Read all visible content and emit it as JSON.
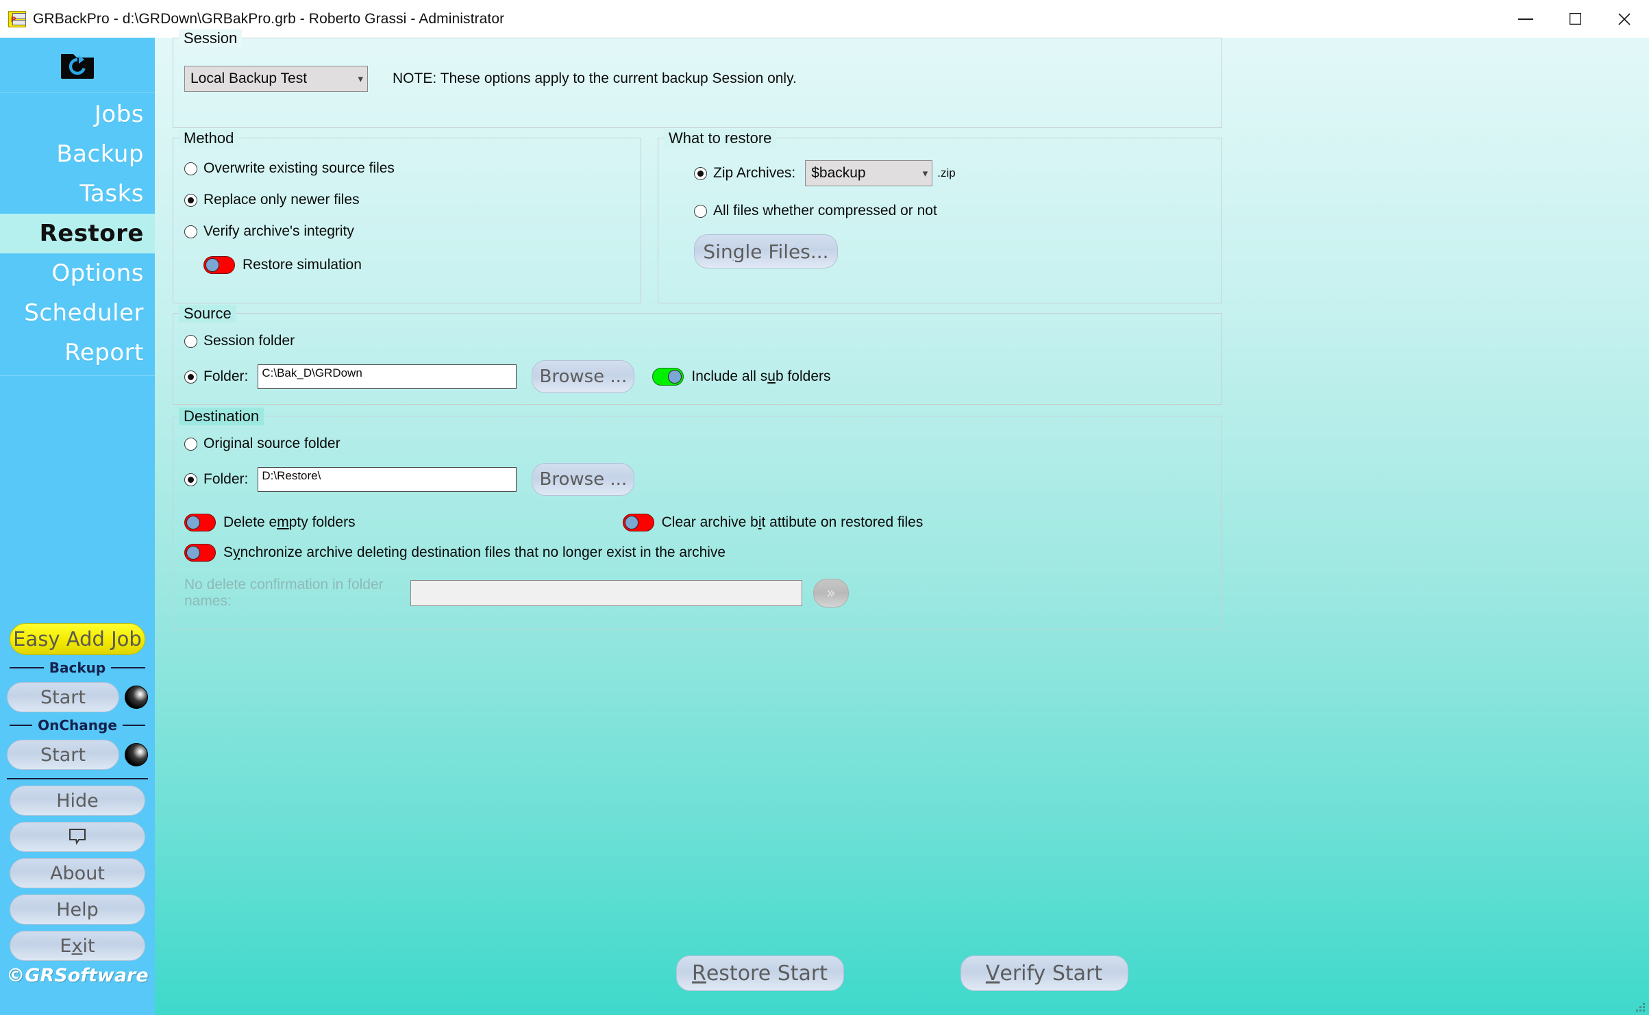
{
  "window": {
    "title": "GRBackPro - d:\\GRDown\\GRBakPro.grb - Roberto Grassi - Administrator",
    "minimize": "—",
    "maximize": "□",
    "close": "✕"
  },
  "sidebar": {
    "logo_name": "restore-folder-logo",
    "items": [
      {
        "label": "Jobs",
        "active": false
      },
      {
        "label": "Backup",
        "active": false
      },
      {
        "label": "Tasks",
        "active": false
      },
      {
        "label": "Restore",
        "active": true
      },
      {
        "label": "Options",
        "active": false
      },
      {
        "label": "Scheduler",
        "active": false
      },
      {
        "label": "Report",
        "active": false
      }
    ],
    "easy_add_job": "Easy Add Job",
    "backup_divider": "Backup",
    "backup_start": "Start",
    "onchange_divider": "OnChange",
    "onchange_start": "Start",
    "hide": "Hide",
    "about": "About",
    "help": "Help",
    "exit_pre": "E",
    "exit_key": "x",
    "exit_post": "it",
    "copyright": "©GRSoftware"
  },
  "session": {
    "legend": "Session",
    "selected": "Local Backup Test",
    "note": "NOTE: These options apply to the current backup Session only."
  },
  "method": {
    "legend": "Method",
    "options": [
      {
        "label": "Overwrite existing source files",
        "selected": false
      },
      {
        "label": "Replace only newer files",
        "selected": true
      },
      {
        "label": "Verify archive's integrity",
        "selected": false
      }
    ],
    "simulation_label": "Restore simulation",
    "simulation_on": false
  },
  "what_to_restore": {
    "legend": "What to restore",
    "zip_label": "Zip Archives:",
    "zip_selected": true,
    "zip_value": "$backup",
    "zip_suffix": ".zip",
    "all_files_label": "All files whether compressed or not",
    "all_files_selected": false,
    "single_files_pre": "Sin",
    "single_files_key": "g",
    "single_files_post": "le Files..."
  },
  "source": {
    "legend": "Source",
    "session_folder_label": "Session folder",
    "session_folder_selected": false,
    "folder_label": "Folder:",
    "folder_selected": true,
    "folder_value": "C:\\Bak_D\\GRDown",
    "browse": "Browse ...",
    "include_sub_pre": "Include all s",
    "include_sub_key": "u",
    "include_sub_post": "b folders",
    "include_sub_on": true
  },
  "destination": {
    "legend": "Destination",
    "original_label": "Original source folder",
    "original_selected": false,
    "folder_label": "Folder:",
    "folder_selected": true,
    "folder_value": "D:\\Restore\\",
    "browse": "Browse ...",
    "delete_empty_pre": "Delete e",
    "delete_empty_key": "m",
    "delete_empty_post": "pty folders",
    "delete_empty_on": false,
    "clear_archive_pre": "Clear archive b",
    "clear_archive_key": "i",
    "clear_archive_post": "t attibute on restored files",
    "clear_archive_on": false,
    "sync_pre": "S",
    "sync_key": "y",
    "sync_post": "nchronize archive deleting destination files that no longer exist in the archive",
    "sync_on": false,
    "no_delete_label": "No delete confirmation in folder names:",
    "no_delete_value": "",
    "no_delete_more": "»"
  },
  "actions": {
    "restore_pre": "",
    "restore_key": "R",
    "restore_post": "estore Start",
    "verify_pre": "",
    "verify_key": "V",
    "verify_post": "erify Start"
  }
}
